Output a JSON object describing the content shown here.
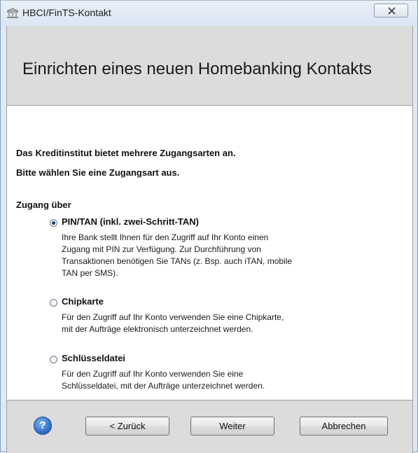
{
  "window": {
    "title": "HBCI/FinTS-Kontakt",
    "close_glyph": "✕"
  },
  "header": {
    "title": "Einrichten eines neuen Homebanking Kontakts"
  },
  "content": {
    "intro_line1": "Das Kreditinstitut bietet mehrere Zugangsarten an.",
    "intro_line2": "Bitte wählen Sie eine Zugangsart aus.",
    "group_label": "Zugang über",
    "options": [
      {
        "label": "PIN/TAN (inkl. zwei-Schritt-TAN)",
        "checked": true,
        "description": [
          "Ihre Bank stellt Ihnen für den Zugriff auf Ihr Konto einen",
          "Zugang mit PIN zur Verfügung. Zur Durchführung von",
          "Transaktionen benötigen Sie TANs (z. Bsp. auch iTAN, mobile",
          "TAN per SMS)."
        ]
      },
      {
        "label": "Chipkarte",
        "checked": false,
        "description": [
          "Für den Zugriff auf Ihr Konto verwenden Sie eine Chipkarte,",
          "mit der Aufträge elektronisch unterzeichnet werden."
        ]
      },
      {
        "label": "Schlüsseldatei",
        "checked": false,
        "description": [
          "Für den Zugriff auf Ihr Konto verwenden Sie eine",
          "Schlüsseldatei, mit der Aufträge unterzeichnet werden."
        ]
      }
    ]
  },
  "footer": {
    "help_glyph": "?",
    "back_label": "< Zurück",
    "next_label": "Weiter",
    "cancel_label": "Abbrechen"
  },
  "icons": {
    "app": "bank-building-icon",
    "close": "close-icon",
    "help": "help-icon"
  }
}
